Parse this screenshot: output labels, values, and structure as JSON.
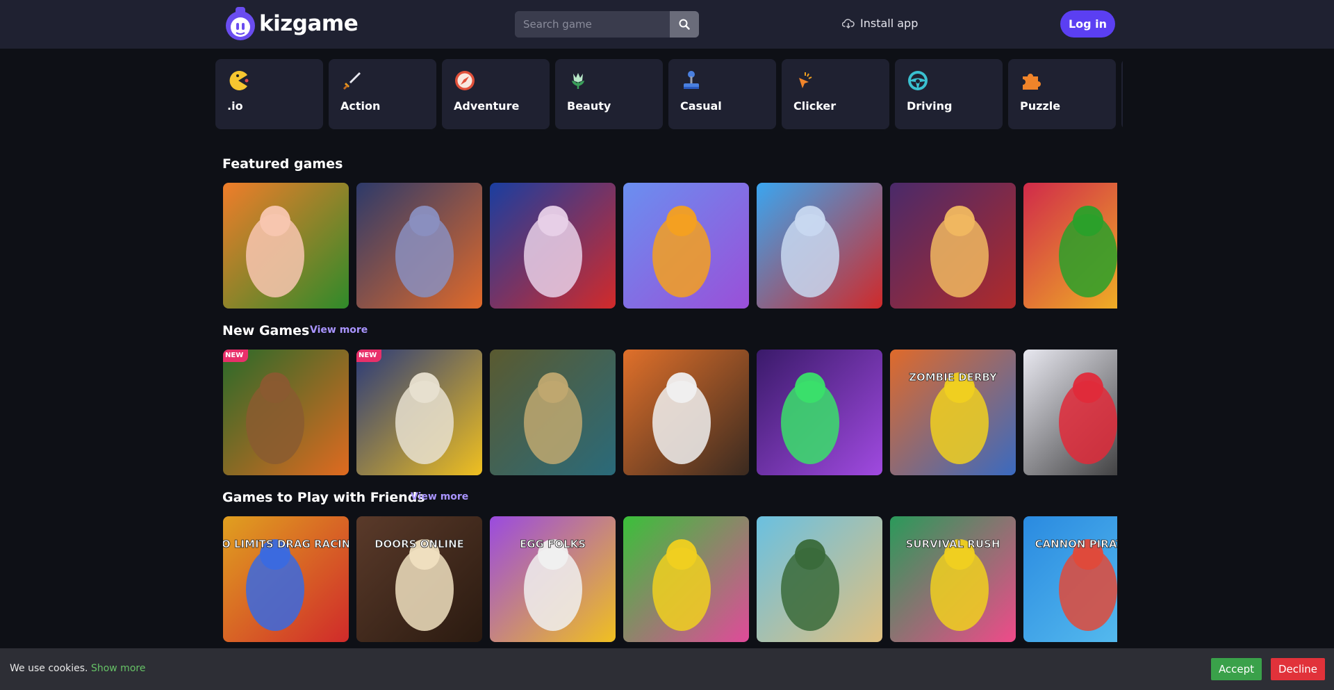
{
  "brand": {
    "name": "kizgame",
    "accent": "#5b3ff2"
  },
  "search": {
    "placeholder": "Search game",
    "icon": "search-icon"
  },
  "header": {
    "install_label": "Install app",
    "login_label": "Log in"
  },
  "categories": [
    {
      "label": ".io",
      "icon": "pacman-icon"
    },
    {
      "label": "Action",
      "icon": "sword-icon"
    },
    {
      "label": "Adventure",
      "icon": "compass-icon"
    },
    {
      "label": "Beauty",
      "icon": "flower-icon"
    },
    {
      "label": "Casual",
      "icon": "joystick-icon"
    },
    {
      "label": "Clicker",
      "icon": "cursor-click-icon"
    },
    {
      "label": "Driving",
      "icon": "steering-wheel-icon"
    },
    {
      "label": "Puzzle",
      "icon": "puzzle-piece-icon"
    }
  ],
  "sections": [
    {
      "title": "Featured games",
      "view_more": "",
      "tiles": [
        {
          "colors": [
            "#f07d2a",
            "#2f8a2a",
            "#f8c6b0"
          ],
          "label": ""
        },
        {
          "colors": [
            "#2d3a6a",
            "#e06a2a",
            "#8a8fc0"
          ],
          "label": ""
        },
        {
          "colors": [
            "#1a3ea0",
            "#d22a2a",
            "#e8d0e8"
          ],
          "label": ""
        },
        {
          "colors": [
            "#6a8ff0",
            "#9a4fd8",
            "#f4a020"
          ],
          "label": ""
        },
        {
          "colors": [
            "#3aa6f0",
            "#d02a2a",
            "#c8d8f0"
          ],
          "label": ""
        },
        {
          "colors": [
            "#4a2a6a",
            "#b02a2a",
            "#f0b860"
          ],
          "label": ""
        },
        {
          "colors": [
            "#d02a4a",
            "#f4c020",
            "#2aa02a"
          ],
          "label": ""
        }
      ]
    },
    {
      "title": "New Games",
      "view_more": "View more",
      "tiles": [
        {
          "colors": [
            "#2a6a2a",
            "#e06a20",
            "#8a5a30"
          ],
          "label": "",
          "badge": "NEW"
        },
        {
          "colors": [
            "#2a3a7a",
            "#f0c020",
            "#e8e0d0"
          ],
          "label": "",
          "badge": "NEW"
        },
        {
          "colors": [
            "#5a5a30",
            "#2a6a7a",
            "#c0a870"
          ],
          "label": ""
        },
        {
          "colors": [
            "#e0702a",
            "#3a2a20",
            "#f0f0f0"
          ],
          "label": ""
        },
        {
          "colors": [
            "#3a1a6a",
            "#a04ae0",
            "#3ae06a"
          ],
          "label": ""
        },
        {
          "colors": [
            "#e06a2a",
            "#3a6ac0",
            "#f0d020"
          ],
          "label": "ZOMBIE DERBY"
        },
        {
          "colors": [
            "#e8e8f0",
            "#2a2a2a",
            "#e02a3a"
          ],
          "label": ""
        }
      ]
    },
    {
      "title": "Games to Play with Friends",
      "view_more": "View more",
      "tiles": [
        {
          "colors": [
            "#e0a020",
            "#d02a2a",
            "#3a6ae0"
          ],
          "label": "NO LIMITS DRAG RACING"
        },
        {
          "colors": [
            "#5a3a2a",
            "#2a1a10",
            "#f0e0c0"
          ],
          "label": "DOORS ONLINE"
        },
        {
          "colors": [
            "#9a4ae0",
            "#f0c020",
            "#f0f0f0"
          ],
          "label": "EGG FOLKS"
        },
        {
          "colors": [
            "#3ac03a",
            "#e04a9a",
            "#f0d020"
          ],
          "label": ""
        },
        {
          "colors": [
            "#6ac0e0",
            "#e0c080",
            "#3a6a3a"
          ],
          "label": ""
        },
        {
          "colors": [
            "#2a9a5a",
            "#f04a8a",
            "#f0d020"
          ],
          "label": "SURVIVAL RUSH"
        },
        {
          "colors": [
            "#2a8ae0",
            "#5ac0f0",
            "#e04a3a"
          ],
          "label": "CANNON PIRATES"
        }
      ]
    }
  ],
  "cookie": {
    "text": "We use cookies.",
    "more_label": "Show more",
    "accept_label": "Accept",
    "decline_label": "Decline"
  }
}
